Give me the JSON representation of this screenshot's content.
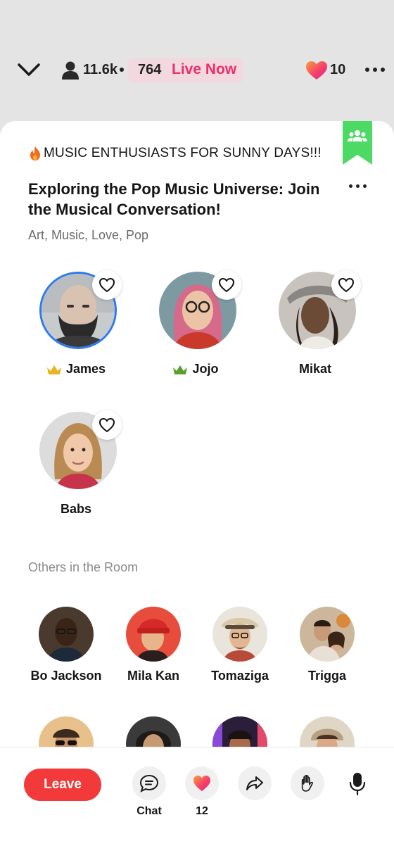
{
  "header": {
    "listener_count": "11.6k",
    "live_count": "764",
    "live_label": "Live Now",
    "likes_count": "10"
  },
  "room": {
    "category": "MUSIC ENTHUSIASTS FOR SUNNY DAYS!!!",
    "title": "Exploring the Pop Music Universe: Join the Musical Conversation!",
    "tags": "Art, Music,  Love, Pop"
  },
  "speakers": [
    {
      "name": "James",
      "crown": "gold"
    },
    {
      "name": "Jojo",
      "crown": "green"
    },
    {
      "name": "Mikat",
      "crown": ""
    },
    {
      "name": "Babs",
      "crown": ""
    }
  ],
  "others_label": "Others in the Room",
  "listeners": [
    {
      "name": "Bo Jackson"
    },
    {
      "name": "Mila Kan"
    },
    {
      "name": "Tomaziga"
    },
    {
      "name": "Trigga"
    }
  ],
  "bottom_bar": {
    "leave_label": "Leave",
    "chat_label": "Chat",
    "like_count": "12"
  },
  "colors": {
    "accent_live": "#ef2f67",
    "leave": "#f23a3a",
    "bookmark": "#4cd964",
    "speaking_ring": "#2b7bf0"
  },
  "icons": [
    "chevron-down-icon",
    "user-icon",
    "heart-icon",
    "more-icon",
    "group-icon",
    "fire-icon",
    "crown-icon",
    "chat-icon",
    "share-icon",
    "raise-hand-icon",
    "mic-icon"
  ]
}
